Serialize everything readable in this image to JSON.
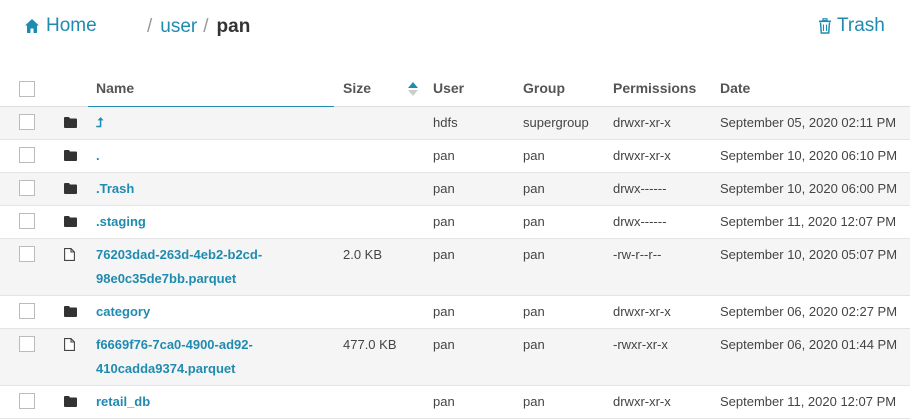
{
  "topbar": {
    "home_label": "Home",
    "breadcrumb": {
      "sep1": "/",
      "segment": "user",
      "sep2": "/",
      "current": "pan"
    },
    "trash_label": "Trash"
  },
  "columns": {
    "name": "Name",
    "size": "Size",
    "user": "User",
    "group": "Group",
    "permissions": "Permissions",
    "date": "Date"
  },
  "rows": [
    {
      "type": "folder",
      "name": "⮥",
      "size": "",
      "user": "hdfs",
      "group": "supergroup",
      "perm": "drwxr-xr-x",
      "date": "September 05, 2020 02:11 PM"
    },
    {
      "type": "folder",
      "name": ".",
      "size": "",
      "user": "pan",
      "group": "pan",
      "perm": "drwxr-xr-x",
      "date": "September 10, 2020 06:10 PM"
    },
    {
      "type": "folder",
      "name": ".Trash",
      "size": "",
      "user": "pan",
      "group": "pan",
      "perm": "drwx------",
      "date": "September 10, 2020 06:00 PM"
    },
    {
      "type": "folder",
      "name": ".staging",
      "size": "",
      "user": "pan",
      "group": "pan",
      "perm": "drwx------",
      "date": "September 11, 2020 12:07 PM"
    },
    {
      "type": "file",
      "name_line1": "76203dad-263d-4eb2-b2cd-",
      "name_line2": "98e0c35de7bb.parquet",
      "size": "2.0 KB",
      "user": "pan",
      "group": "pan",
      "perm": "-rw-r--r--",
      "date": "September 10, 2020 05:07 PM"
    },
    {
      "type": "folder",
      "name": "category",
      "size": "",
      "user": "pan",
      "group": "pan",
      "perm": "drwxr-xr-x",
      "date": "September 06, 2020 02:27 PM"
    },
    {
      "type": "file",
      "name_line1": "f6669f76-7ca0-4900-ad92-",
      "name_line2": "410cadda9374.parquet",
      "size": "477.0 KB",
      "user": "pan",
      "group": "pan",
      "perm": "-rwxr-xr-x",
      "date": "September 06, 2020 01:44 PM"
    },
    {
      "type": "folder",
      "name": "retail_db",
      "size": "",
      "user": "pan",
      "group": "pan",
      "perm": "drwxr-xr-x",
      "date": "September 11, 2020 12:07 PM"
    }
  ]
}
